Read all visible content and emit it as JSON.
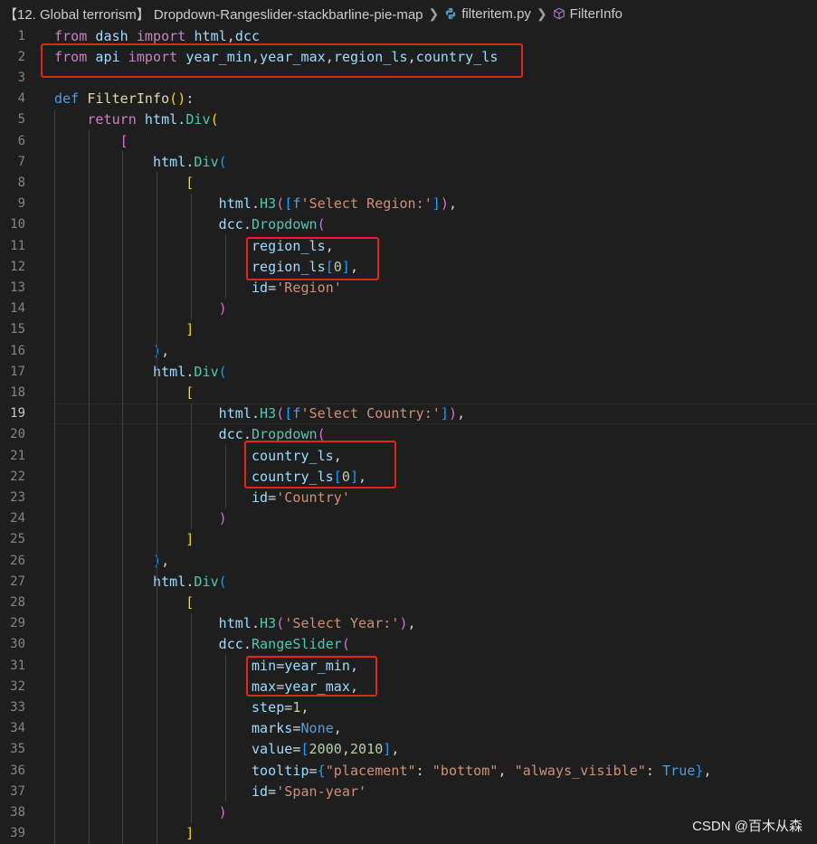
{
  "breadcrumb": {
    "folder": "【12. Global terrorism】 Dropdown-Rangeslider-stackbarline-pie-map",
    "file": "filteritem.py",
    "symbol": "FilterInfo"
  },
  "watermark": "CSDN @百木从森",
  "active_line": 19,
  "lines": [
    {
      "n": "1",
      "tokens": [
        [
          "kw2",
          "from"
        ],
        [
          "plain",
          " "
        ],
        [
          "var",
          "dash"
        ],
        [
          "plain",
          " "
        ],
        [
          "kw2",
          "import"
        ],
        [
          "plain",
          " "
        ],
        [
          "var",
          "html"
        ],
        [
          "plain",
          ","
        ],
        [
          "var",
          "dcc"
        ]
      ]
    },
    {
      "n": "2",
      "tokens": [
        [
          "kw2",
          "from"
        ],
        [
          "plain",
          " "
        ],
        [
          "var",
          "api"
        ],
        [
          "plain",
          " "
        ],
        [
          "kw2",
          "import"
        ],
        [
          "plain",
          " "
        ],
        [
          "var",
          "year_min"
        ],
        [
          "plain",
          ","
        ],
        [
          "var",
          "year_max"
        ],
        [
          "plain",
          ","
        ],
        [
          "var",
          "region_ls"
        ],
        [
          "plain",
          ","
        ],
        [
          "var",
          "country_ls"
        ]
      ]
    },
    {
      "n": "3",
      "tokens": []
    },
    {
      "n": "4",
      "tokens": [
        [
          "kw",
          "def"
        ],
        [
          "plain",
          " "
        ],
        [
          "fn",
          "FilterInfo"
        ],
        [
          "br1",
          "("
        ],
        [
          "br1",
          ")"
        ],
        [
          "plain",
          ":"
        ]
      ]
    },
    {
      "n": "5",
      "tokens": [
        [
          "plain",
          "    "
        ],
        [
          "kw2",
          "return"
        ],
        [
          "plain",
          " "
        ],
        [
          "var",
          "html"
        ],
        [
          "plain",
          "."
        ],
        [
          "cls",
          "Div"
        ],
        [
          "br1",
          "("
        ]
      ]
    },
    {
      "n": "6",
      "tokens": [
        [
          "plain",
          "        "
        ],
        [
          "br2",
          "["
        ]
      ]
    },
    {
      "n": "7",
      "tokens": [
        [
          "plain",
          "            "
        ],
        [
          "var",
          "html"
        ],
        [
          "plain",
          "."
        ],
        [
          "cls",
          "Div"
        ],
        [
          "br3",
          "("
        ]
      ]
    },
    {
      "n": "8",
      "tokens": [
        [
          "plain",
          "                "
        ],
        [
          "br1",
          "["
        ]
      ]
    },
    {
      "n": "9",
      "tokens": [
        [
          "plain",
          "                    "
        ],
        [
          "var",
          "html"
        ],
        [
          "plain",
          "."
        ],
        [
          "cls",
          "H3"
        ],
        [
          "br2",
          "("
        ],
        [
          "br3",
          "["
        ],
        [
          "kw",
          "f"
        ],
        [
          "str",
          "'Select Region:'"
        ],
        [
          "br3",
          "]"
        ],
        [
          "br2",
          ")"
        ],
        [
          "plain",
          ","
        ]
      ]
    },
    {
      "n": "10",
      "tokens": [
        [
          "plain",
          "                    "
        ],
        [
          "var",
          "dcc"
        ],
        [
          "plain",
          "."
        ],
        [
          "cls",
          "Dropdown"
        ],
        [
          "br2",
          "("
        ]
      ]
    },
    {
      "n": "11",
      "tokens": [
        [
          "plain",
          "                        "
        ],
        [
          "var",
          "region_ls"
        ],
        [
          "plain",
          ","
        ]
      ]
    },
    {
      "n": "12",
      "tokens": [
        [
          "plain",
          "                        "
        ],
        [
          "var",
          "region_ls"
        ],
        [
          "br3",
          "["
        ],
        [
          "num",
          "0"
        ],
        [
          "br3",
          "]"
        ],
        [
          "plain",
          ","
        ]
      ]
    },
    {
      "n": "13",
      "tokens": [
        [
          "plain",
          "                        "
        ],
        [
          "var",
          "id"
        ],
        [
          "plain",
          "="
        ],
        [
          "str",
          "'Region'"
        ]
      ]
    },
    {
      "n": "14",
      "tokens": [
        [
          "plain",
          "                    "
        ],
        [
          "br2",
          ")"
        ]
      ]
    },
    {
      "n": "15",
      "tokens": [
        [
          "plain",
          "                "
        ],
        [
          "br1",
          "]"
        ]
      ]
    },
    {
      "n": "16",
      "tokens": [
        [
          "plain",
          "            "
        ],
        [
          "br3",
          ")"
        ],
        [
          "plain",
          ","
        ]
      ]
    },
    {
      "n": "17",
      "tokens": [
        [
          "plain",
          "            "
        ],
        [
          "var",
          "html"
        ],
        [
          "plain",
          "."
        ],
        [
          "cls",
          "Div"
        ],
        [
          "br3",
          "("
        ]
      ]
    },
    {
      "n": "18",
      "tokens": [
        [
          "plain",
          "                "
        ],
        [
          "br1",
          "["
        ]
      ]
    },
    {
      "n": "19",
      "tokens": [
        [
          "plain",
          "                    "
        ],
        [
          "var",
          "html"
        ],
        [
          "plain",
          "."
        ],
        [
          "cls",
          "H3"
        ],
        [
          "br2",
          "("
        ],
        [
          "br3",
          "["
        ],
        [
          "kw",
          "f"
        ],
        [
          "str",
          "'Select Country:'"
        ],
        [
          "br3",
          "]"
        ],
        [
          "br2",
          ")"
        ],
        [
          "plain",
          ","
        ]
      ]
    },
    {
      "n": "20",
      "tokens": [
        [
          "plain",
          "                    "
        ],
        [
          "var",
          "dcc"
        ],
        [
          "plain",
          "."
        ],
        [
          "cls",
          "Dropdown"
        ],
        [
          "br2",
          "("
        ]
      ]
    },
    {
      "n": "21",
      "tokens": [
        [
          "plain",
          "                        "
        ],
        [
          "var",
          "country_ls"
        ],
        [
          "plain",
          ","
        ]
      ]
    },
    {
      "n": "22",
      "tokens": [
        [
          "plain",
          "                        "
        ],
        [
          "var",
          "country_ls"
        ],
        [
          "br3",
          "["
        ],
        [
          "num",
          "0"
        ],
        [
          "br3",
          "]"
        ],
        [
          "plain",
          ","
        ]
      ]
    },
    {
      "n": "23",
      "tokens": [
        [
          "plain",
          "                        "
        ],
        [
          "var",
          "id"
        ],
        [
          "plain",
          "="
        ],
        [
          "str",
          "'Country'"
        ]
      ]
    },
    {
      "n": "24",
      "tokens": [
        [
          "plain",
          "                    "
        ],
        [
          "br2",
          ")"
        ]
      ]
    },
    {
      "n": "25",
      "tokens": [
        [
          "plain",
          "                "
        ],
        [
          "br1",
          "]"
        ]
      ]
    },
    {
      "n": "26",
      "tokens": [
        [
          "plain",
          "            "
        ],
        [
          "br3",
          ")"
        ],
        [
          "plain",
          ","
        ]
      ]
    },
    {
      "n": "27",
      "tokens": [
        [
          "plain",
          "            "
        ],
        [
          "var",
          "html"
        ],
        [
          "plain",
          "."
        ],
        [
          "cls",
          "Div"
        ],
        [
          "br3",
          "("
        ]
      ]
    },
    {
      "n": "28",
      "tokens": [
        [
          "plain",
          "                "
        ],
        [
          "br1",
          "["
        ]
      ]
    },
    {
      "n": "29",
      "tokens": [
        [
          "plain",
          "                    "
        ],
        [
          "var",
          "html"
        ],
        [
          "plain",
          "."
        ],
        [
          "cls",
          "H3"
        ],
        [
          "br2",
          "("
        ],
        [
          "str",
          "'Select Year:'"
        ],
        [
          "br2",
          ")"
        ],
        [
          "plain",
          ","
        ]
      ]
    },
    {
      "n": "30",
      "tokens": [
        [
          "plain",
          "                    "
        ],
        [
          "var",
          "dcc"
        ],
        [
          "plain",
          "."
        ],
        [
          "cls",
          "RangeSlider"
        ],
        [
          "br2",
          "("
        ]
      ]
    },
    {
      "n": "31",
      "tokens": [
        [
          "plain",
          "                        "
        ],
        [
          "var",
          "min"
        ],
        [
          "plain",
          "="
        ],
        [
          "var",
          "year_min"
        ],
        [
          "plain",
          ","
        ]
      ]
    },
    {
      "n": "32",
      "tokens": [
        [
          "plain",
          "                        "
        ],
        [
          "var",
          "max"
        ],
        [
          "plain",
          "="
        ],
        [
          "var",
          "year_max"
        ],
        [
          "plain",
          ","
        ]
      ]
    },
    {
      "n": "33",
      "tokens": [
        [
          "plain",
          "                        "
        ],
        [
          "var",
          "step"
        ],
        [
          "plain",
          "="
        ],
        [
          "num",
          "1"
        ],
        [
          "plain",
          ","
        ]
      ]
    },
    {
      "n": "34",
      "tokens": [
        [
          "plain",
          "                        "
        ],
        [
          "var",
          "marks"
        ],
        [
          "plain",
          "="
        ],
        [
          "kw",
          "None"
        ],
        [
          "plain",
          ","
        ]
      ]
    },
    {
      "n": "35",
      "tokens": [
        [
          "plain",
          "                        "
        ],
        [
          "var",
          "value"
        ],
        [
          "plain",
          "="
        ],
        [
          "br3",
          "["
        ],
        [
          "num",
          "2000"
        ],
        [
          "plain",
          ","
        ],
        [
          "num",
          "2010"
        ],
        [
          "br3",
          "]"
        ],
        [
          "plain",
          ","
        ]
      ]
    },
    {
      "n": "36",
      "tokens": [
        [
          "plain",
          "                        "
        ],
        [
          "var",
          "tooltip"
        ],
        [
          "plain",
          "="
        ],
        [
          "br3",
          "{"
        ],
        [
          "str",
          "\"placement\""
        ],
        [
          "plain",
          ": "
        ],
        [
          "str",
          "\"bottom\""
        ],
        [
          "plain",
          ", "
        ],
        [
          "str",
          "\"always_visible\""
        ],
        [
          "plain",
          ": "
        ],
        [
          "kw",
          "True"
        ],
        [
          "br3",
          "}"
        ],
        [
          "plain",
          ","
        ]
      ]
    },
    {
      "n": "37",
      "tokens": [
        [
          "plain",
          "                        "
        ],
        [
          "var",
          "id"
        ],
        [
          "plain",
          "="
        ],
        [
          "str",
          "'Span-year'"
        ]
      ]
    },
    {
      "n": "38",
      "tokens": [
        [
          "plain",
          "                    "
        ],
        [
          "br2",
          ")"
        ]
      ]
    },
    {
      "n": "39",
      "tokens": [
        [
          "plain",
          "                "
        ],
        [
          "br1",
          "]"
        ]
      ]
    }
  ]
}
